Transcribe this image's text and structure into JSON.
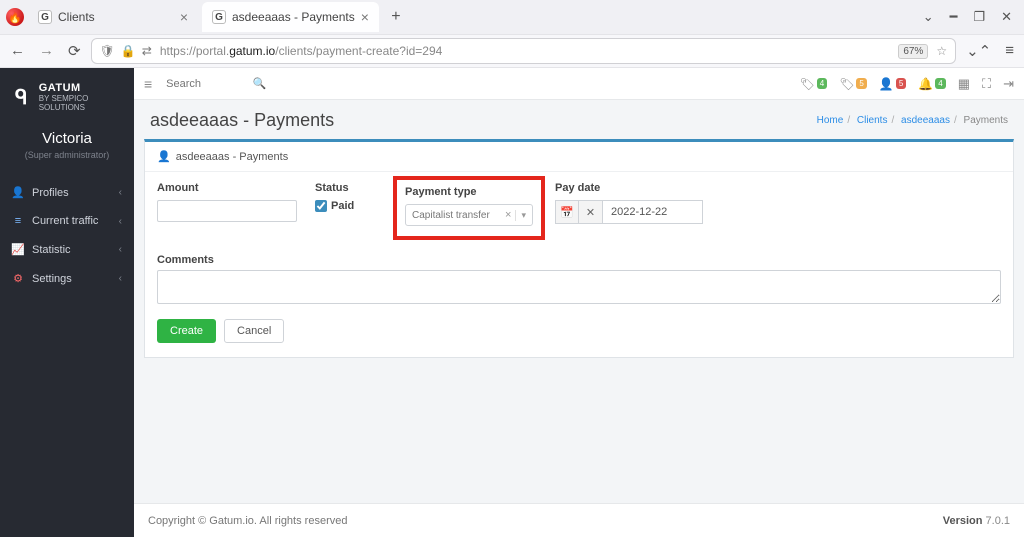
{
  "browser": {
    "tabs": [
      {
        "title": "Clients"
      },
      {
        "title": "asdeeaaas - Payments"
      }
    ],
    "url_prefix": "https://portal.",
    "url_domain": "gatum.io",
    "url_path": "/clients/payment-create?id=294",
    "zoom": "67%"
  },
  "brand": {
    "name": "GATUM",
    "sub": "BY SEMPICO SOLUTIONS"
  },
  "user": {
    "name": "Victoria",
    "role": "(Super administrator)"
  },
  "sidebar": {
    "items": [
      {
        "label": "Profiles"
      },
      {
        "label": "Current traffic"
      },
      {
        "label": "Statistic"
      },
      {
        "label": "Settings"
      }
    ]
  },
  "topbar": {
    "search_placeholder": "Search",
    "badges": [
      "4",
      "5",
      "5",
      "4"
    ]
  },
  "breadcrumb": {
    "home": "Home",
    "clients": "Clients",
    "client": "asdeeaaas",
    "current": "Payments"
  },
  "page": {
    "title": "asdeeaaas - Payments",
    "panel_title": "asdeeaaas - Payments"
  },
  "form": {
    "amount_label": "Amount",
    "amount_value": "",
    "status_label": "Status",
    "paid_label": "Paid",
    "paid_checked": true,
    "ptype_label": "Payment type",
    "ptype_value": "Capitalist transfer",
    "paydate_label": "Pay date",
    "paydate_value": "2022-12-22",
    "comments_label": "Comments",
    "comments_value": "",
    "create_label": "Create",
    "cancel_label": "Cancel"
  },
  "footer": {
    "copyright": "Copyright © Gatum.io. All rights reserved",
    "version_label": "Version",
    "version": "7.0.1"
  }
}
